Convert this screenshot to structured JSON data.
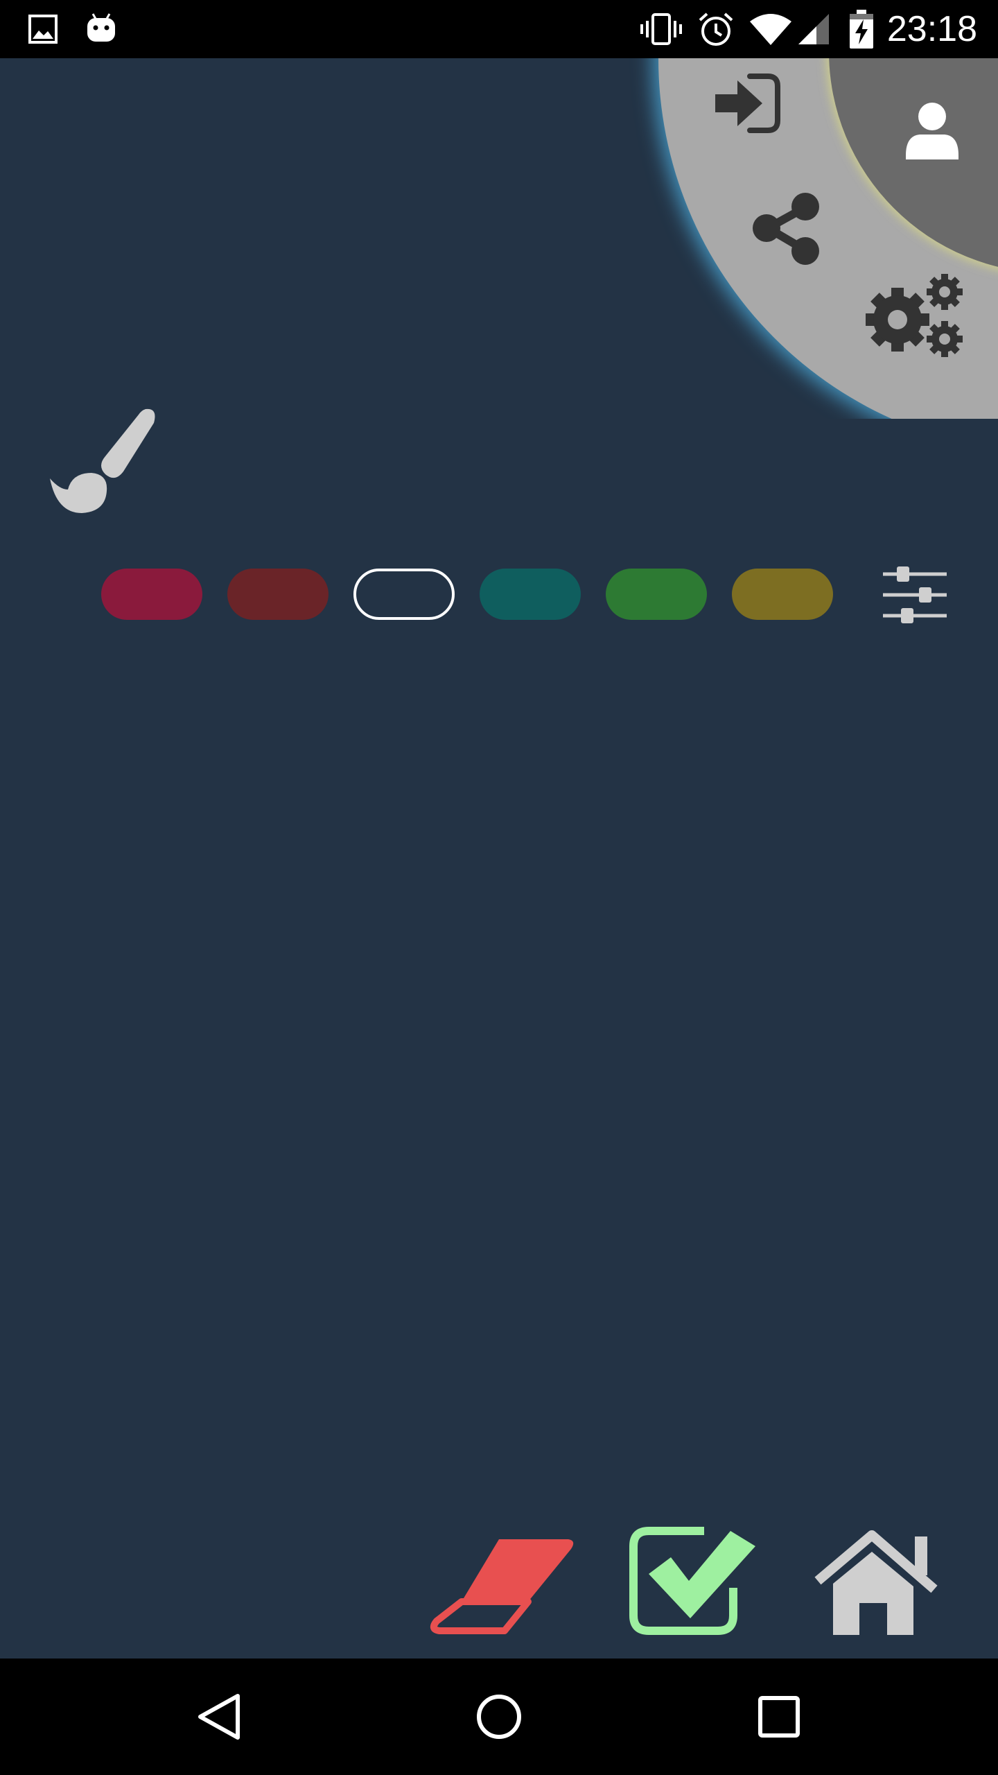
{
  "status_bar": {
    "time": "23:18",
    "left_icons": [
      "image-icon",
      "android-icon"
    ],
    "right_icons": [
      "vibrate-icon",
      "alarm-icon",
      "wifi-icon",
      "signal-icon",
      "battery-charging-icon"
    ]
  },
  "radial_menu": {
    "items": [
      "login-icon",
      "user-icon",
      "share-icon",
      "settings-gears-icon"
    ]
  },
  "palette": {
    "swatches": [
      {
        "name": "swatch-crimson",
        "color": "#8a1a3c",
        "selected": false
      },
      {
        "name": "swatch-maroon",
        "color": "#6a2428",
        "selected": false
      },
      {
        "name": "swatch-white",
        "color": "#ffffff",
        "selected": true
      },
      {
        "name": "swatch-teal",
        "color": "#0f5e5e",
        "selected": false
      },
      {
        "name": "swatch-green",
        "color": "#2d7a33",
        "selected": false
      },
      {
        "name": "swatch-olive",
        "color": "#7d6e22",
        "selected": false
      }
    ]
  },
  "tools": {
    "eraser_color": "#e85050",
    "confirm_color": "#9ef0a0",
    "home_color": "#cfcfcf"
  },
  "colors": {
    "background": "#233345",
    "radial_outer": "#a9a9a9",
    "radial_inner": "#6a6a6a",
    "icon_dark": "#333333",
    "icon_light": "#cfcfcf"
  }
}
